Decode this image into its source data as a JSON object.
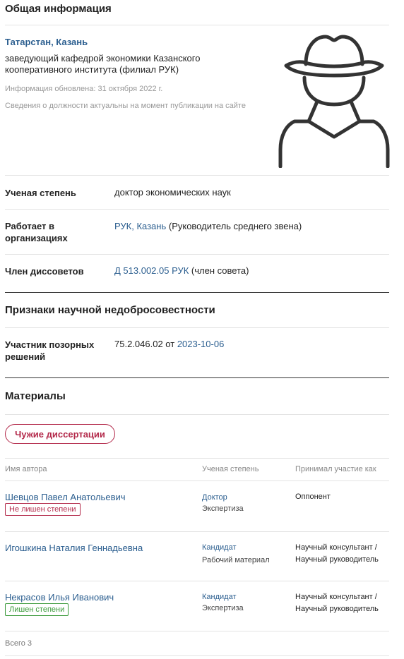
{
  "general": {
    "title": "Общая информация",
    "location": "Татарстан, Казань",
    "position": "заведующий кафедрой экономики Казанского кооперативного института (филиал РУК)",
    "updated": "Информация обновлена: 31 октября 2022 г.",
    "note": "Сведения о должности актуальны на момент публикации на сайте",
    "avatar_icon": "anonymous-hat-avatar-icon"
  },
  "details": {
    "degree_label": "Ученая степень",
    "degree_value": "доктор экономических наук",
    "works_label_1": "Работает в",
    "works_label_2": "организациях",
    "works_link": "РУК, Казань",
    "works_note": " (Руководитель среднего звена)",
    "council_label": "Член диссоветов",
    "council_link": "Д 513.002.05 РУК",
    "council_note": " (член совета)"
  },
  "misconduct": {
    "title": "Признаки научной недобросовестности",
    "label_1": "Участник позорных",
    "label_2": "решений",
    "value": "75.2.046.02 от ",
    "date_link": "2023-10-06"
  },
  "materials": {
    "title": "Материалы",
    "tab_label": "Чужие диссертации",
    "columns": [
      "Имя автора",
      "Ученая степень",
      "Принимал участие как"
    ],
    "rows": [
      {
        "name": "Шевцов Павел Анатольевич",
        "badge": "Не лишен степени",
        "degree": "Доктор",
        "type": "Экспертиза",
        "role_1": "Оппонент",
        "role_2": ""
      },
      {
        "name": "Игошкина Наталия Геннадьевна",
        "badge": "",
        "degree": "Кандидат",
        "type": "Рабочий материал",
        "role_1": "Научный консультант /",
        "role_2": "Научный руководитель"
      },
      {
        "name": "Некрасов Илья Иванович",
        "badge": "Лишен степени",
        "degree": "Кандидат",
        "type": "Экспертиза",
        "role_1": "Научный консультант /",
        "role_2": "Научный руководитель"
      }
    ],
    "total": "Всего 3"
  },
  "colors": {
    "link": "#2b5e8f",
    "accent_red": "#b3294a",
    "accent_green": "#3a9a3a"
  }
}
